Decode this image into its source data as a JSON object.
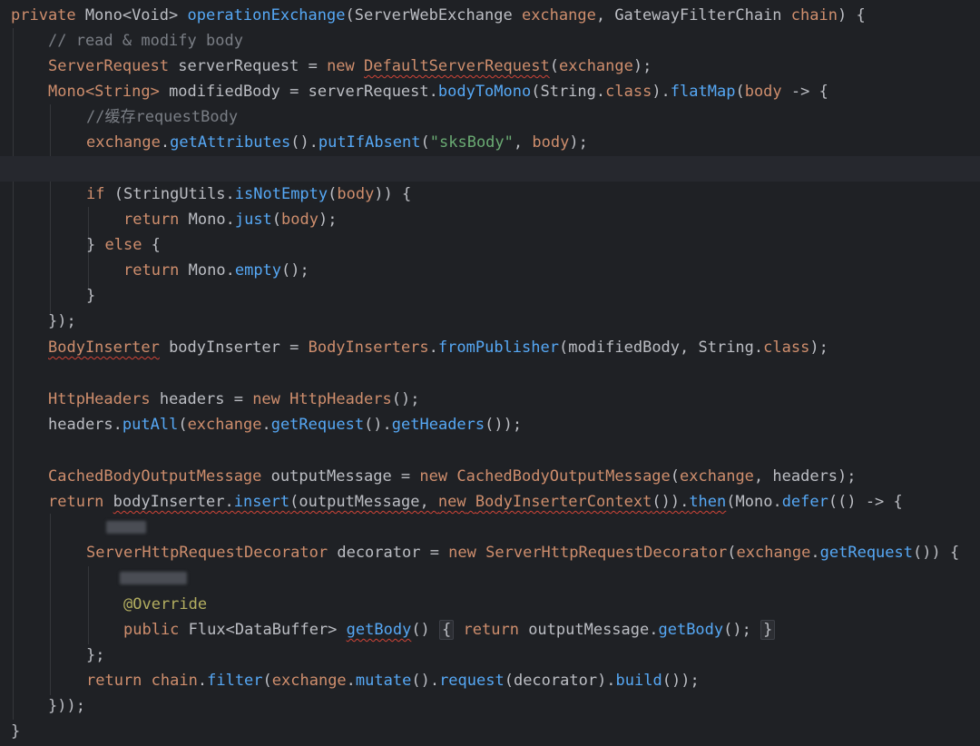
{
  "colors": {
    "background": "#1f2125",
    "current_line": "#26282e",
    "keyword": "#cf8e6d",
    "method": "#56a8f5",
    "string": "#6aab73",
    "comment": "#7a7e85",
    "annotation": "#b3ae60",
    "plain": "#bcbec4",
    "error_underline": "#d04437"
  },
  "code": {
    "l1": {
      "kw_private": "private",
      "t1": " Mono<Void> ",
      "fn": "operationExchange",
      "t2": "(ServerWebExchange ",
      "p1": "exchange",
      "t3": ", GatewayFilterChain ",
      "p2": "chain",
      "t4": ") {"
    },
    "l2": {
      "comment": "// read & modify body"
    },
    "l3": {
      "type": "ServerRequest",
      "t1": " serverRequest = ",
      "kw_new": "new",
      "t2": " ",
      "cls": "DefaultServerRequest",
      "t3": "(",
      "p": "exchange",
      "t4": ");"
    },
    "l4": {
      "type": "Mono<String>",
      "t1": " modifiedBody = serverRequest.",
      "fn1": "bodyToMono",
      "t2": "(String.",
      "kw_class": "class",
      "t3": ").",
      "fn2": "flatMap",
      "t4": "(",
      "p": "body",
      "t5": " -> {"
    },
    "l5": {
      "comment": "//缓存requestBody"
    },
    "l6": {
      "p": "exchange",
      "t1": ".",
      "fn1": "getAttributes",
      "t2": "().",
      "fn2": "putIfAbsent",
      "t3": "(",
      "str": "\"sksBody\"",
      "t4": ", ",
      "p2": "body",
      "t5": ");"
    },
    "l8": {
      "kw_if": "if",
      "t1": " (StringUtils.",
      "fn": "isNotEmpty",
      "t2": "(",
      "p": "body",
      "t3": ")) {"
    },
    "l9": {
      "kw_return": "return",
      "t1": " Mono.",
      "fn": "just",
      "t2": "(",
      "p": "body",
      "t3": ");"
    },
    "l10": {
      "t1": "} ",
      "kw_else": "else",
      "t2": " {"
    },
    "l11": {
      "kw_return": "return",
      "t1": " Mono.",
      "fn": "empty",
      "t2": "();"
    },
    "l12": {
      "t1": "}"
    },
    "l13": {
      "t1": "});"
    },
    "l14": {
      "type": "BodyInserter",
      "t1": " bodyInserter = ",
      "type2": "BodyInserters",
      "t2": ".",
      "fn": "fromPublisher",
      "t3": "(modifiedBody, String.",
      "kw_class": "class",
      "t4": ");"
    },
    "l16": {
      "type": "HttpHeaders",
      "t1": " headers = ",
      "kw_new": "new",
      "t2": " ",
      "cls": "HttpHeaders",
      "t3": "();"
    },
    "l17": {
      "t1": "headers.",
      "fn1": "putAll",
      "t2": "(",
      "p": "exchange",
      "t3": ".",
      "fn2": "getRequest",
      "t4": "().",
      "fn3": "getHeaders",
      "t5": "());"
    },
    "l19": {
      "type": "CachedBodyOutputMessage",
      "t1": " outputMessage = ",
      "kw_new": "new",
      "t2": " ",
      "cls": "CachedBodyOutputMessage",
      "t3": "(",
      "p": "exchange",
      "t4": ", headers);"
    },
    "l20": {
      "kw_return": "return",
      "t1": " ",
      "u1": "bodyInserter.",
      "fn1": "insert",
      "u2": "(outputMessage, ",
      "kw_new": "new",
      "u3": " ",
      "cls": "BodyInserterContext",
      "u4": "()).",
      "fn2": "then",
      "t2": "(Mono.",
      "fn3": "defer",
      "t3": "(() -> {"
    },
    "l22": {
      "type": "ServerHttpRequestDecorator",
      "t1": " decorator = ",
      "kw_new": "new",
      "t2": " ",
      "cls": "ServerHttpRequestDecorator",
      "t3": "(",
      "p": "exchange",
      "t4": ".",
      "fn": "getRequest",
      "t5": "()) {"
    },
    "l24": {
      "ann": "@Override"
    },
    "l25": {
      "kw_public": "public",
      "t1": " Flux<DataBuffer> ",
      "fn": "getBody",
      "t2": "() ",
      "fold_open": "{",
      "t3": " ",
      "kw_return": "return",
      "t4": " outputMessage.",
      "fn2": "getBody",
      "t5": "(); ",
      "fold_close": "}"
    },
    "l26": {
      "t1": "};"
    },
    "l27": {
      "kw_return": "return",
      "t1": " ",
      "p": "chain",
      "t2": ".",
      "fn1": "filter",
      "t3": "(",
      "p2": "exchange",
      "t4": ".",
      "fn2": "mutate",
      "t5": "().",
      "fn3": "request",
      "t6": "(decorator).",
      "fn4": "build",
      "t7": "());"
    },
    "l28": {
      "t1": "}));"
    },
    "l29": {
      "t1": "}"
    }
  }
}
